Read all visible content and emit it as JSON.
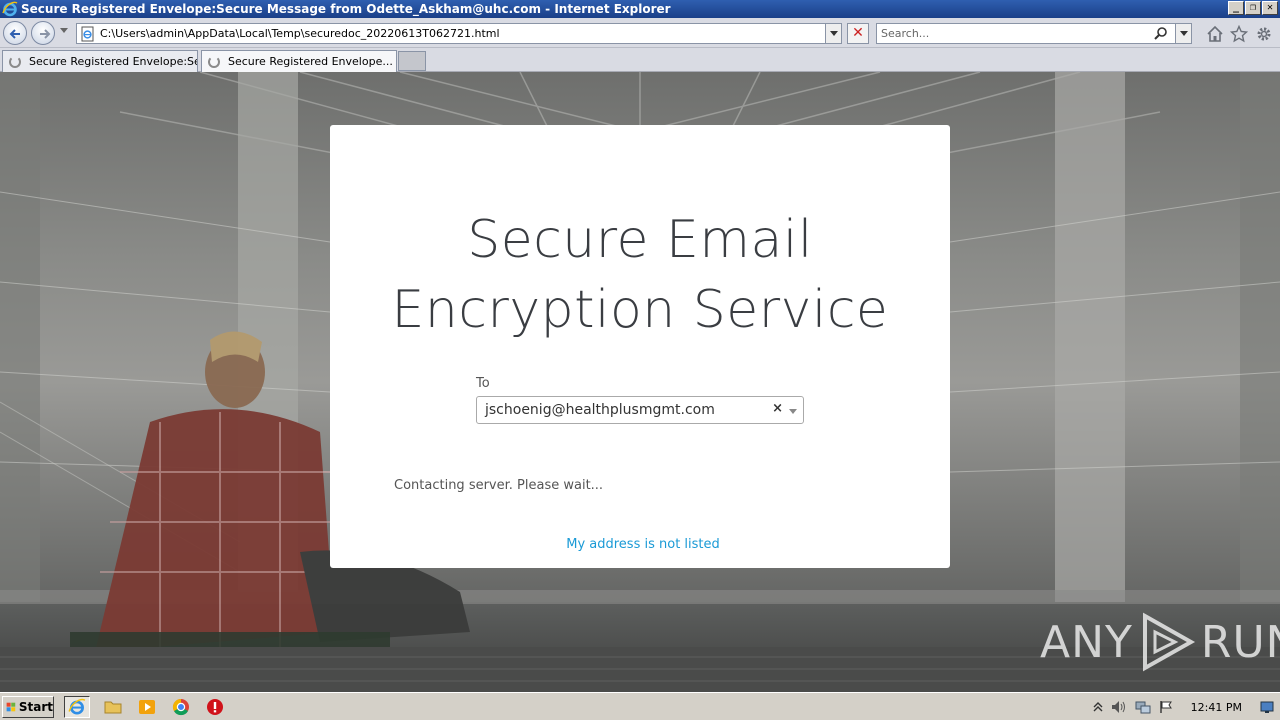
{
  "window": {
    "title": "Secure Registered Envelope:Secure Message from Odette_Askham@uhc.com - Internet Explorer",
    "controls": [
      "_",
      "❐",
      "✕"
    ]
  },
  "navbar": {
    "url": "C:\\Users\\admin\\AppData\\Local\\Temp\\securedoc_20220613T062721.html",
    "search_placeholder": "Search...",
    "stop_label": "✕"
  },
  "tabs": [
    {
      "label": "Secure Registered Envelope:Se..."
    },
    {
      "label": "Secure Registered Envelope...",
      "close": "✕"
    }
  ],
  "card": {
    "heading_line1": "Secure Email",
    "heading_line2": "Encryption Service",
    "to_label": "To",
    "recipient": "jschoenig@healthplusmgmt.com",
    "clear": "×",
    "status": "Contacting server. Please wait...",
    "link": "My address is not listed"
  },
  "watermark": {
    "left": "ANY",
    "right": "RUN"
  },
  "taskbar": {
    "start_label": "Start",
    "clock": "12:41 PM"
  }
}
